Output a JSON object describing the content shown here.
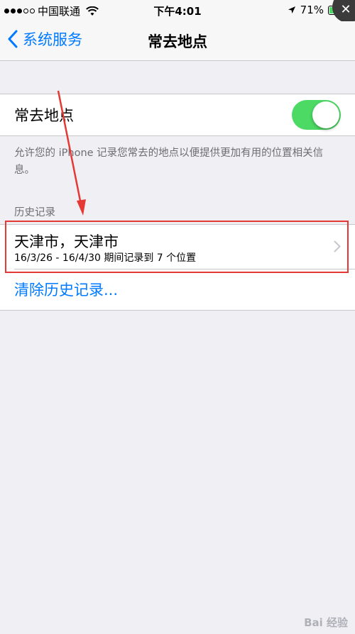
{
  "status_bar": {
    "carrier": "中国联通",
    "time": "下午4:01",
    "battery_percent": "71%",
    "battery_level": 0.71
  },
  "nav": {
    "back_label": "系统服务",
    "title": "常去地点"
  },
  "toggle_cell": {
    "label": "常去地点",
    "enabled": true
  },
  "footer_text": "允许您的 iPhone 记录您常去的地点以便提供更加有用的位置相关信息。",
  "history_section": {
    "header": "历史记录",
    "items": [
      {
        "title": "天津市，天津市",
        "subtitle": "16/3/26 - 16/4/30 期间记录到 7 个位置"
      }
    ],
    "clear_label": "清除历史记录..."
  },
  "watermark": "Bai 经验",
  "colors": {
    "accent": "#007aff",
    "toggle_on": "#4cd964",
    "annotation": "#e53935",
    "background": "#efeff4"
  }
}
